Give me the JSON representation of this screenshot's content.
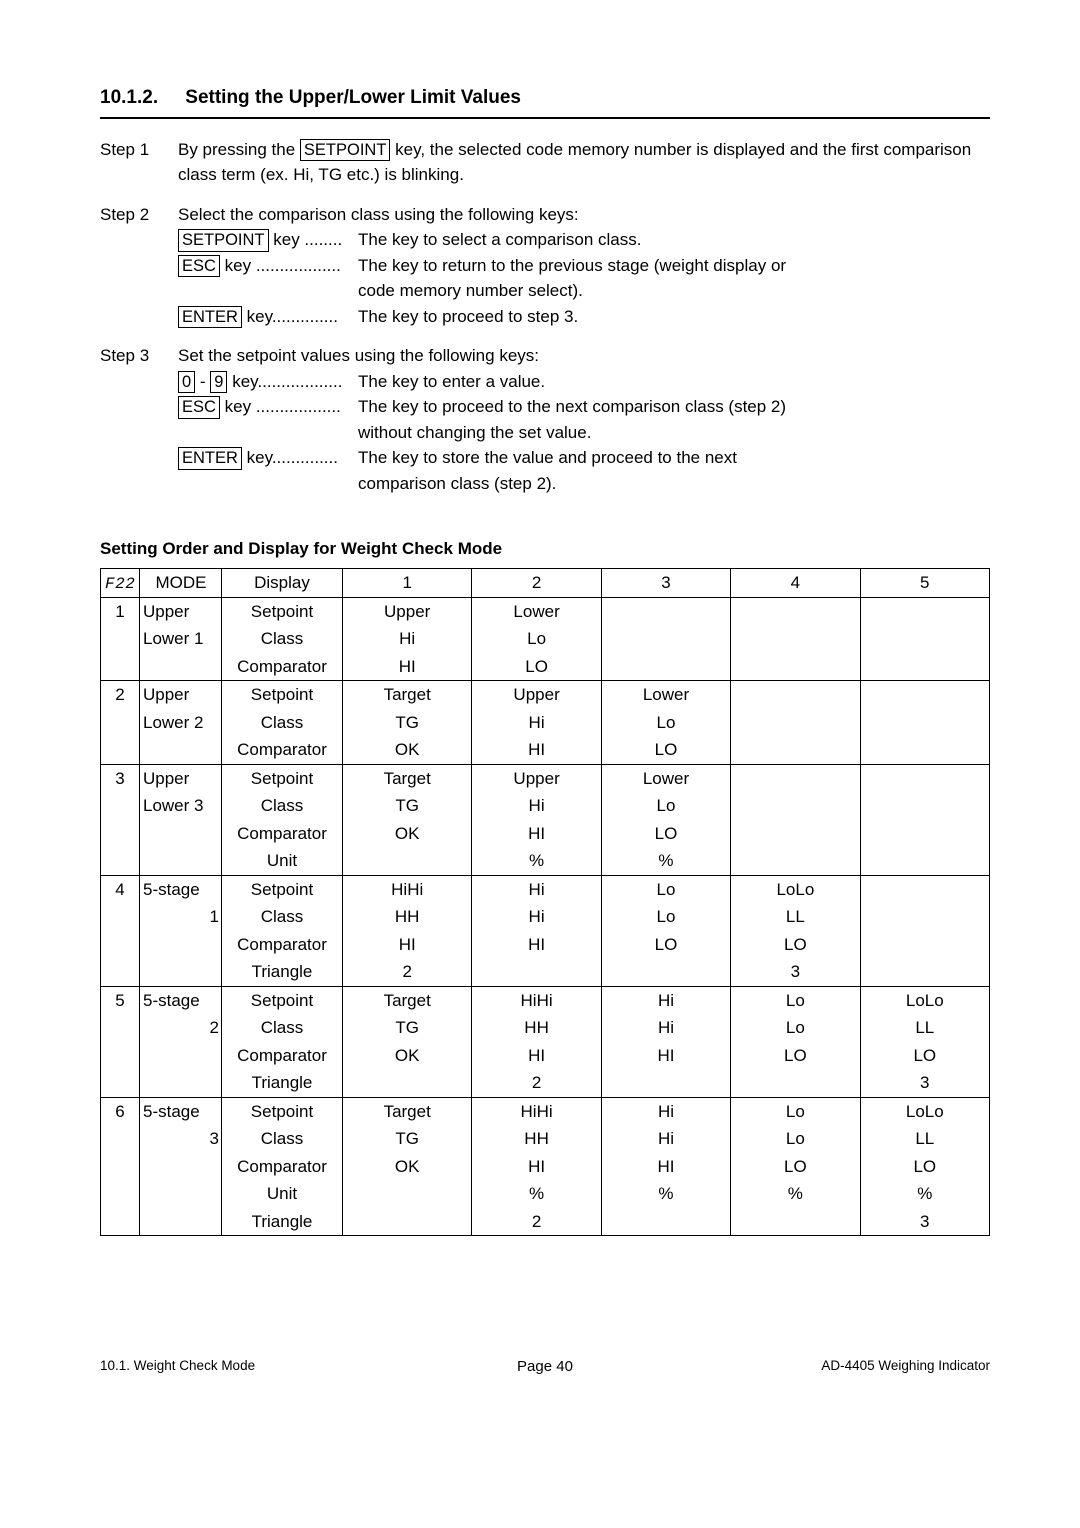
{
  "heading": {
    "num": "10.1.2.",
    "title": "Setting the Upper/Lower Limit Values"
  },
  "steps": {
    "s1": {
      "label": "Step 1",
      "t1": "By pressing the ",
      "key1": "SETPOINT",
      "t2": " key, the selected code memory number is displayed and the first comparison class term (ex. Hi, TG etc.) is blinking."
    },
    "s2": {
      "label": "Step 2",
      "intro": "Select the comparison class using the following keys:",
      "k1": {
        "box": "SETPOINT",
        "post": " key ........",
        "desc": "The key to select a comparison class."
      },
      "k2": {
        "box": "ESC",
        "post": " key ..................",
        "desc1": "The key to return to the previous stage (weight display or",
        "desc2": "code memory number select)."
      },
      "k3": {
        "box": "ENTER",
        "post": " key..............",
        "desc": "The key to proceed to step 3."
      }
    },
    "s3": {
      "label": "Step 3",
      "intro": "Set the setpoint values using the following keys:",
      "k1": {
        "boxA": "0",
        "dash": " - ",
        "boxB": "9",
        "post": " key..................",
        "desc": "The key to enter a value."
      },
      "k2": {
        "box": "ESC",
        "post": " key ..................",
        "desc1": "The key to proceed to the next comparison class (step 2)",
        "desc2": "without changing the set value."
      },
      "k3": {
        "box": "ENTER",
        "post": " key..............",
        "desc1": "The key to store the value and proceed to the next",
        "desc2": "comparison class (step 2)."
      }
    }
  },
  "subheading": "Setting Order and Display for Weight Check Mode",
  "table": {
    "hdr": {
      "f22": "F22",
      "mode": "MODE",
      "disp": "Display",
      "c1": "1",
      "c2": "2",
      "c3": "3",
      "c4": "4",
      "c5": "5"
    },
    "g1": {
      "idx": "1",
      "m1": "Upper",
      "m2": "Lower 1",
      "r1": {
        "d": "Setpoint",
        "c1": "Upper",
        "c2": "Lower",
        "c3": "",
        "c4": "",
        "c5": ""
      },
      "r2": {
        "d": "Class",
        "c1": "Hi",
        "c2": "Lo",
        "c3": "",
        "c4": "",
        "c5": ""
      },
      "r3": {
        "d": "Comparator",
        "c1": "HI",
        "c2": "LO",
        "c3": "",
        "c4": "",
        "c5": ""
      }
    },
    "g2": {
      "idx": "2",
      "m1": "Upper",
      "m2": "Lower 2",
      "r1": {
        "d": "Setpoint",
        "c1": "Target",
        "c2": "Upper",
        "c3": "Lower",
        "c4": "",
        "c5": ""
      },
      "r2": {
        "d": "Class",
        "c1": "TG",
        "c2": "Hi",
        "c3": "Lo",
        "c4": "",
        "c5": ""
      },
      "r3": {
        "d": "Comparator",
        "c1": "OK",
        "c2": "HI",
        "c3": "LO",
        "c4": "",
        "c5": ""
      }
    },
    "g3": {
      "idx": "3",
      "m1": "Upper",
      "m2": "Lower 3",
      "r1": {
        "d": "Setpoint",
        "c1": "Target",
        "c2": "Upper",
        "c3": "Lower",
        "c4": "",
        "c5": ""
      },
      "r2": {
        "d": "Class",
        "c1": "TG",
        "c2": "Hi",
        "c3": "Lo",
        "c4": "",
        "c5": ""
      },
      "r3": {
        "d": "Comparator",
        "c1": "OK",
        "c2": "HI",
        "c3": "LO",
        "c4": "",
        "c5": ""
      },
      "r4": {
        "d": "Unit",
        "c1": "",
        "c2": "%",
        "c3": "%",
        "c4": "",
        "c5": ""
      }
    },
    "g4": {
      "idx": "4",
      "m1": "5-stage",
      "m2": "1",
      "r1": {
        "d": "Setpoint",
        "c1": "HiHi",
        "c2": "Hi",
        "c3": "Lo",
        "c4": "LoLo",
        "c5": ""
      },
      "r2": {
        "d": "Class",
        "c1": "HH",
        "c2": "Hi",
        "c3": "Lo",
        "c4": "LL",
        "c5": ""
      },
      "r3": {
        "d": "Comparator",
        "c1": "HI",
        "c2": "HI",
        "c3": "LO",
        "c4": "LO",
        "c5": ""
      },
      "r4": {
        "d": "Triangle",
        "c1": "2",
        "c2": "",
        "c3": "",
        "c4": "3",
        "c5": ""
      }
    },
    "g5": {
      "idx": "5",
      "m1": "5-stage",
      "m2": "2",
      "r1": {
        "d": "Setpoint",
        "c1": "Target",
        "c2": "HiHi",
        "c3": "Hi",
        "c4": "Lo",
        "c5": "LoLo"
      },
      "r2": {
        "d": "Class",
        "c1": "TG",
        "c2": "HH",
        "c3": "Hi",
        "c4": "Lo",
        "c5": "LL"
      },
      "r3": {
        "d": "Comparator",
        "c1": "OK",
        "c2": "HI",
        "c3": "HI",
        "c4": "LO",
        "c5": "LO"
      },
      "r4": {
        "d": "Triangle",
        "c1": "",
        "c2": "2",
        "c3": "",
        "c4": "",
        "c5": "3"
      }
    },
    "g6": {
      "idx": "6",
      "m1": "5-stage",
      "m2": "3",
      "r1": {
        "d": "Setpoint",
        "c1": "Target",
        "c2": "HiHi",
        "c3": "Hi",
        "c4": "Lo",
        "c5": "LoLo"
      },
      "r2": {
        "d": "Class",
        "c1": "TG",
        "c2": "HH",
        "c3": "Hi",
        "c4": "Lo",
        "c5": "LL"
      },
      "r3": {
        "d": "Comparator",
        "c1": "OK",
        "c2": "HI",
        "c3": "HI",
        "c4": "LO",
        "c5": "LO"
      },
      "r4": {
        "d": "Unit",
        "c1": "",
        "c2": "%",
        "c3": "%",
        "c4": "%",
        "c5": "%"
      },
      "r5": {
        "d": "Triangle",
        "c1": "",
        "c2": "2",
        "c3": "",
        "c4": "",
        "c5": "3"
      }
    }
  },
  "footer": {
    "left": "10.1. Weight Check Mode",
    "mid": "Page 40",
    "right": "AD-4405 Weighing Indicator"
  }
}
